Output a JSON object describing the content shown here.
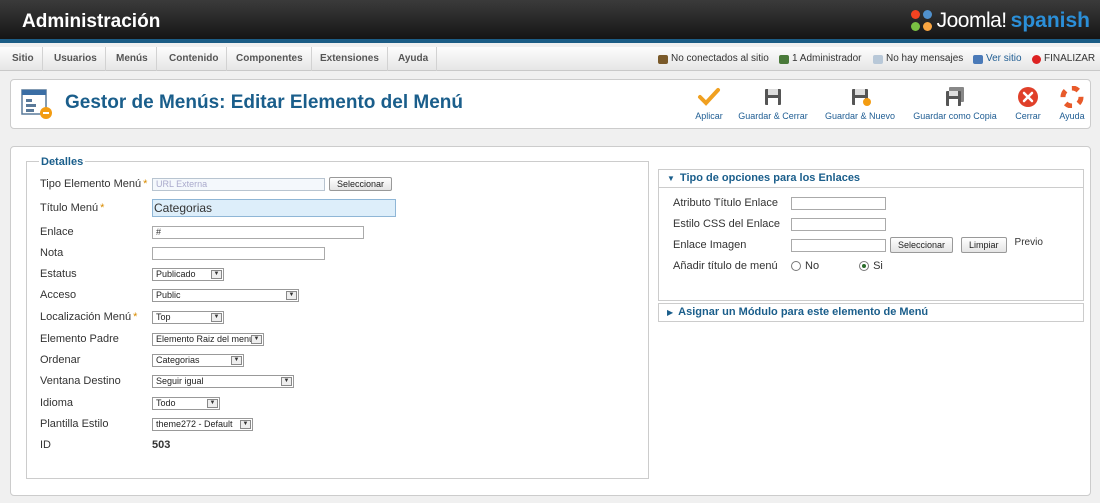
{
  "header": {
    "title": "Administración",
    "logo_text": "Joomla!",
    "logo_sub": "spanish"
  },
  "menubar": {
    "items": [
      "Sitio",
      "Usuarios",
      "Menús",
      "Contenido",
      "Componentes",
      "Extensiones",
      "Ayuda"
    ],
    "status": {
      "offline": "No conectados al sitio",
      "admins": "1 Administrador",
      "messages": "No hay mensajes",
      "view_site": "Ver sitio",
      "logout": "FINALIZAR"
    }
  },
  "toolbar": {
    "page_title": "Gestor de Menús: Editar Elemento del Menú",
    "buttons": {
      "apply": "Aplicar",
      "save_close": "Guardar & Cerrar",
      "save_new": "Guardar & Nuevo",
      "save_copy": "Guardar como Copia",
      "close": "Cerrar",
      "help": "Ayuda"
    }
  },
  "details": {
    "legend": "Detalles",
    "type_label": "Tipo Elemento Menú",
    "type_value": "URL Externa",
    "select_button": "Seleccionar",
    "title_label": "Título Menú",
    "title_value": "Categorias",
    "link_label": "Enlace",
    "link_value": "#",
    "note_label": "Nota",
    "note_value": "",
    "status_label": "Estatus",
    "status_value": "Publicado",
    "access_label": "Acceso",
    "access_value": "Public",
    "location_label": "Localización Menú",
    "location_value": "Top",
    "parent_label": "Elemento Padre",
    "parent_value": "Elemento Raiz del menú",
    "order_label": "Ordenar",
    "order_value": "Categorias",
    "target_label": "Ventana Destino",
    "target_value": "Seguir igual",
    "language_label": "Idioma",
    "language_value": "Todo",
    "template_label": "Plantilla Estilo",
    "template_value": "theme272 - Default",
    "id_label": "ID",
    "id_value": "503"
  },
  "link_options": {
    "heading": "Tipo de opciones para los Enlaces",
    "title_attr_label": "Atributo Título Enlace",
    "css_label": "Estilo CSS del Enlace",
    "image_label": "Enlace Imagen",
    "select_button": "Seleccionar",
    "clear_button": "Limpiar",
    "preview_label": "Previo",
    "add_title_label": "Añadir título de menú",
    "no_label": "No",
    "yes_label": "Si",
    "selected": "Si"
  },
  "module_panel": {
    "heading": "Asignar un Módulo para este elemento de Menú"
  },
  "colors": {
    "accent": "#1a5e8b",
    "header_bg": "#2a2a2a",
    "required": "#d98c00"
  }
}
